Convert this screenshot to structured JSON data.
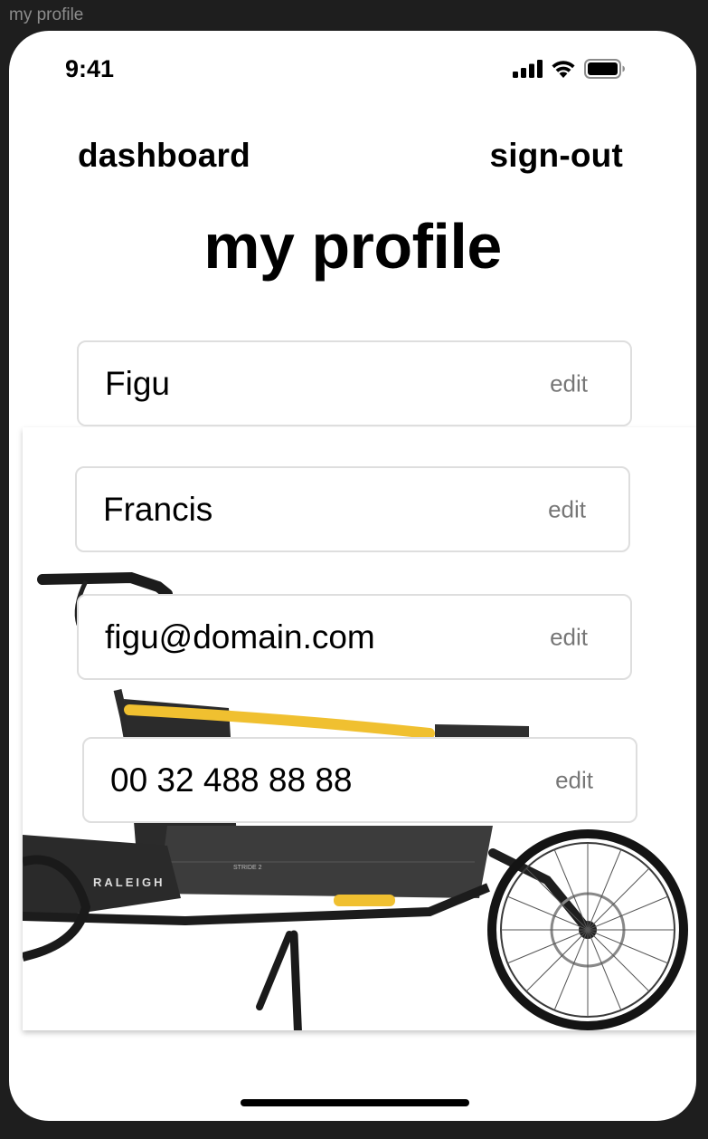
{
  "frame": {
    "title": "my profile"
  },
  "status_bar": {
    "time": "9:41",
    "icons": [
      "signal-icon",
      "wifi-icon",
      "battery-icon"
    ]
  },
  "nav": {
    "dashboard_label": "dashboard",
    "signout_label": "sign-out"
  },
  "page": {
    "title": "my profile"
  },
  "fields": [
    {
      "value": "Figu",
      "action": "edit"
    },
    {
      "value": "Francis",
      "action": "edit"
    },
    {
      "value": "figu@domain.com",
      "action": "edit"
    },
    {
      "value": "00 32 488 88 88",
      "action": "edit"
    }
  ],
  "image": {
    "brand_text": "RALEIGH",
    "model_text": "STRIDE 2",
    "accent": "#f0c030"
  }
}
